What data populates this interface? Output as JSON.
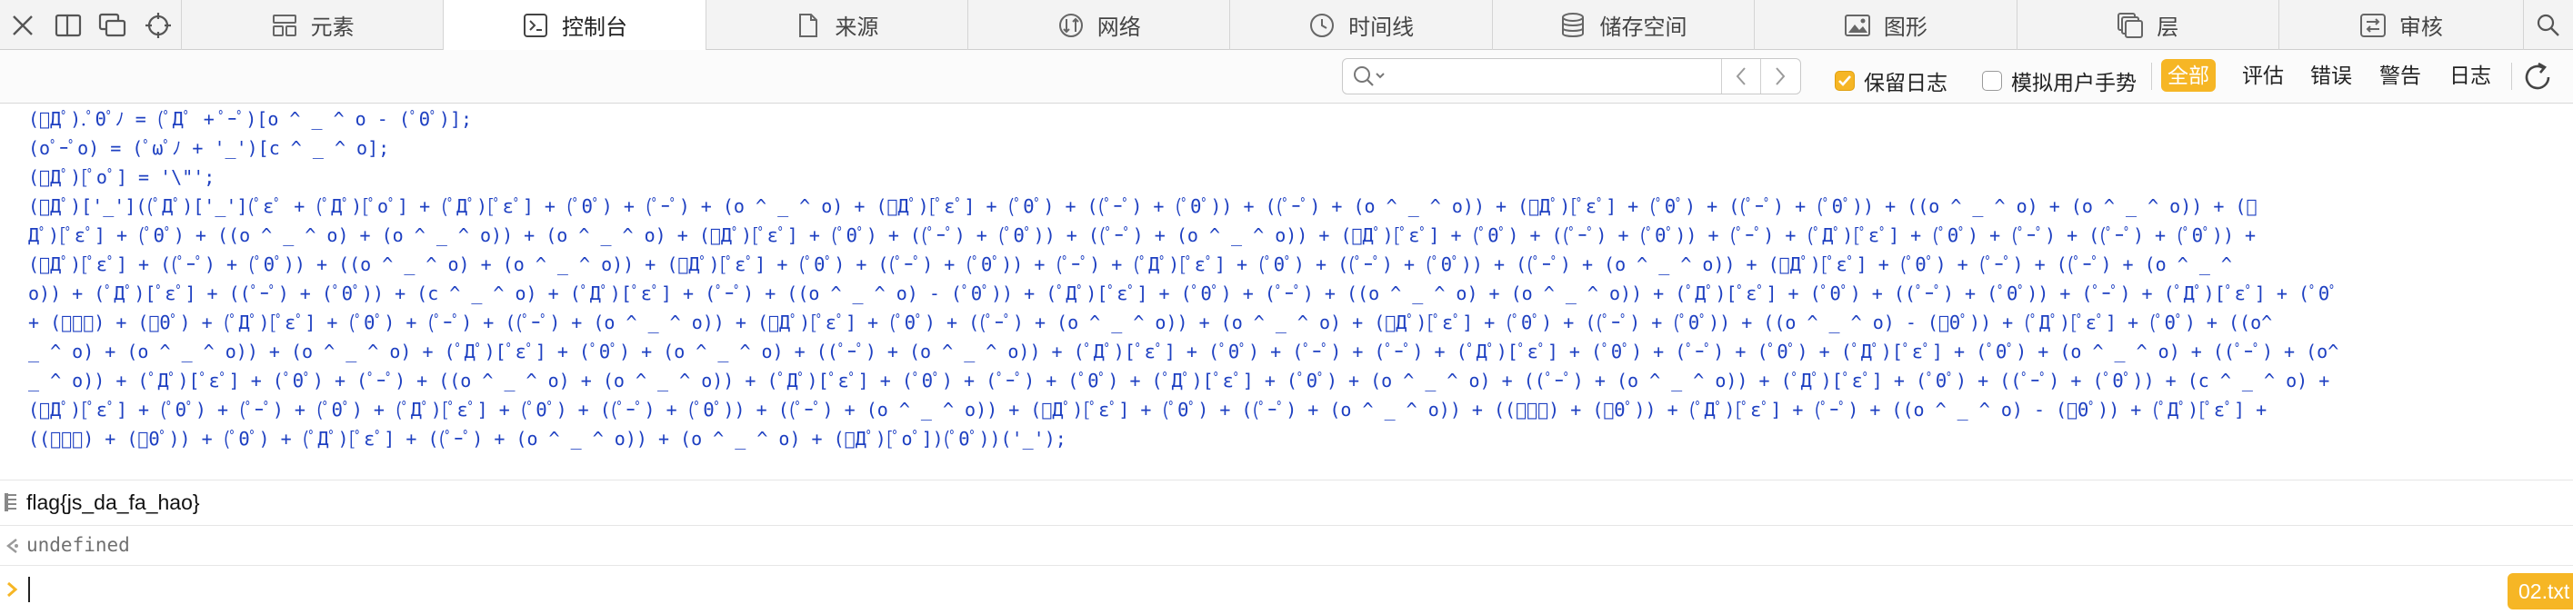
{
  "tabs": [
    {
      "label": "元素",
      "icon": "elements-icon"
    },
    {
      "label": "控制台",
      "icon": "console-icon",
      "active": true
    },
    {
      "label": "来源",
      "icon": "sources-icon"
    },
    {
      "label": "网络",
      "icon": "network-icon"
    },
    {
      "label": "时间线",
      "icon": "timeline-icon"
    },
    {
      "label": "储存空间",
      "icon": "storage-icon"
    },
    {
      "label": "图形",
      "icon": "graphics-icon"
    },
    {
      "label": "层",
      "icon": "layers-icon"
    },
    {
      "label": "审核",
      "icon": "audit-icon"
    }
  ],
  "filter": {
    "search_placeholder": "",
    "preserve_log": {
      "label": "保留日志",
      "checked": true
    },
    "simulate_gesture": {
      "label": "模拟用户手势",
      "checked": false
    },
    "levels": [
      {
        "label": "全部",
        "active": true
      },
      {
        "label": "评估",
        "active": false
      },
      {
        "label": "错误",
        "active": false
      },
      {
        "label": "警告",
        "active": false
      },
      {
        "label": "日志",
        "active": false
      }
    ]
  },
  "console": {
    "code_lines": [
      "(ﾟДﾟ).ﾟΘﾟﾉ = (ﾟДﾟ + ﾟｰﾟ)[o ^ _ ^ o - (ﾟΘﾟ)];",
      "(oﾟｰﾟo) = (ﾟωﾟﾉ + '_')[c ^ _ ^ o];",
      "(ﾟДﾟ)[ﾟoﾟ] = '\\\"';",
      "(ﾟДﾟ)['_']((ﾟДﾟ)['_'](ﾟεﾟ + (ﾟДﾟ)[ﾟoﾟ] + (ﾟДﾟ)[ﾟεﾟ] + (ﾟΘﾟ) + (ﾟｰﾟ) + (o ^ _ ^ o) + (ﾟДﾟ)[ﾟεﾟ] + (ﾟΘﾟ) + ((ﾟｰﾟ) + (ﾟΘﾟ)) + ((ﾟｰﾟ) + (o ^ _ ^ o)) + (ﾟДﾟ)[ﾟεﾟ] + (ﾟΘﾟ) + ((ﾟｰﾟ) + (ﾟΘﾟ)) + ((o ^ _ ^ o) + (o ^ _ ^ o)) + (ﾟ",
      "Дﾟ)[ﾟεﾟ] + (ﾟΘﾟ) + ((o ^ _ ^ o) + (o ^ _ ^ o)) + (o ^ _ ^ o) + (ﾟДﾟ)[ﾟεﾟ] + (ﾟΘﾟ) + ((ﾟｰﾟ) + (ﾟΘﾟ)) + ((ﾟｰﾟ) + (o ^ _ ^ o)) + (ﾟДﾟ)[ﾟεﾟ] + (ﾟΘﾟ) + ((ﾟｰﾟ) + (ﾟΘﾟ)) + (ﾟｰﾟ) + (ﾟДﾟ)[ﾟεﾟ] + (ﾟΘﾟ) + (ﾟｰﾟ) + ((ﾟｰﾟ) + (ﾟΘﾟ)) +",
      "(ﾟДﾟ)[ﾟεﾟ] + ((ﾟｰﾟ) + (ﾟΘﾟ)) + ((o ^ _ ^ o) + (o ^ _ ^ o)) + (ﾟДﾟ)[ﾟεﾟ] + (ﾟΘﾟ) + ((ﾟｰﾟ) + (ﾟΘﾟ)) + (ﾟｰﾟ) + (ﾟДﾟ)[ﾟεﾟ] + (ﾟΘﾟ) + ((ﾟｰﾟ) + (ﾟΘﾟ)) + ((ﾟｰﾟ) + (o ^ _ ^ o)) + (ﾟДﾟ)[ﾟεﾟ] + (ﾟΘﾟ) + (ﾟｰﾟ) + ((ﾟｰﾟ) + (o ^ _ ^",
      "o)) + (ﾟДﾟ)[ﾟεﾟ] + ((ﾟｰﾟ) + (ﾟΘﾟ)) + (c ^ _ ^ o) + (ﾟДﾟ)[ﾟεﾟ] + (ﾟｰﾟ) + ((o ^ _ ^ o) - (ﾟΘﾟ)) + (ﾟДﾟ)[ﾟεﾟ] + (ﾟΘﾟ) + (ﾟｰﾟ) + ((o ^ _ ^ o) + (o ^ _ ^ o)) + (ﾟДﾟ)[ﾟεﾟ] + (ﾟΘﾟ) + ((ﾟｰﾟ) + (ﾟΘﾟ)) + (ﾟｰﾟ) + (ﾟДﾟ)[ﾟεﾟ] + (ﾟΘﾟ",
      "+ (ﾟｰﾟ) + (ﾟΘﾟ) + (ﾟДﾟ)[ﾟεﾟ] + (ﾟΘﾟ) + (ﾟｰﾟ) + ((ﾟｰﾟ) + (o ^ _ ^ o)) + (ﾟДﾟ)[ﾟεﾟ] + (ﾟΘﾟ) + ((ﾟｰﾟ) + (o ^ _ ^ o)) + (o ^ _ ^ o) + (ﾟДﾟ)[ﾟεﾟ] + (ﾟΘﾟ) + ((ﾟｰﾟ) + (ﾟΘﾟ)) + ((o ^ _ ^ o) - (ﾟΘﾟ)) + (ﾟДﾟ)[ﾟεﾟ] + (ﾟΘﾟ) + ((o^",
      "_ ^ o) + (o ^ _ ^ o)) + (o ^ _ ^ o) + (ﾟДﾟ)[ﾟεﾟ] + (ﾟΘﾟ) + (o ^ _ ^ o) + ((ﾟｰﾟ) + (o ^ _ ^ o)) + (ﾟДﾟ)[ﾟεﾟ] + (ﾟΘﾟ) + (ﾟｰﾟ) + (ﾟｰﾟ) + (ﾟДﾟ)[ﾟεﾟ] + (ﾟΘﾟ) + (ﾟｰﾟ) + (ﾟΘﾟ) + (ﾟДﾟ)[ﾟεﾟ] + (ﾟΘﾟ) + (o ^ _ ^ o) + ((ﾟｰﾟ) + (o^",
      "_ ^ o)) + (ﾟДﾟ)[ﾟεﾟ] + (ﾟΘﾟ) + (ﾟｰﾟ) + ((o ^ _ ^ o) + (o ^ _ ^ o)) + (ﾟДﾟ)[ﾟεﾟ] + (ﾟΘﾟ) + (ﾟｰﾟ) + (ﾟΘﾟ) + (ﾟДﾟ)[ﾟεﾟ] + (ﾟΘﾟ) + (o ^ _ ^ o) + ((ﾟｰﾟ) + (o ^ _ ^ o)) + (ﾟДﾟ)[ﾟεﾟ] + (ﾟΘﾟ) + ((ﾟｰﾟ) + (ﾟΘﾟ)) + (c ^ _ ^ o) +",
      "(ﾟДﾟ)[ﾟεﾟ] + (ﾟΘﾟ) + (ﾟｰﾟ) + (ﾟΘﾟ) + (ﾟДﾟ)[ﾟεﾟ] + (ﾟΘﾟ) + ((ﾟｰﾟ) + (ﾟΘﾟ)) + ((ﾟｰﾟ) + (o ^ _ ^ o)) + (ﾟДﾟ)[ﾟεﾟ] + (ﾟΘﾟ) + ((ﾟｰﾟ) + (o ^ _ ^ o)) + ((ﾟｰﾟ) + (ﾟΘﾟ)) + (ﾟДﾟ)[ﾟεﾟ] + (ﾟｰﾟ) + ((o ^ _ ^ o) - (ﾟΘﾟ)) + (ﾟДﾟ)[ﾟεﾟ] +",
      "((ﾟｰﾟ) + (ﾟΘﾟ)) + (ﾟΘﾟ) + (ﾟДﾟ)[ﾟεﾟ] + ((ﾟｰﾟ) + (o ^ _ ^ o)) + (o ^ _ ^ o) + (ﾟДﾟ)[ﾟoﾟ])(ﾟΘﾟ))('_');"
    ],
    "output": "flag{js_da_fa_hao}",
    "return_value": "undefined",
    "prompt_value": "",
    "file_badge": "02.txt"
  },
  "colors": {
    "accent": "#f6b625",
    "code_text": "#1d3fc1",
    "return_text": "#707070"
  }
}
